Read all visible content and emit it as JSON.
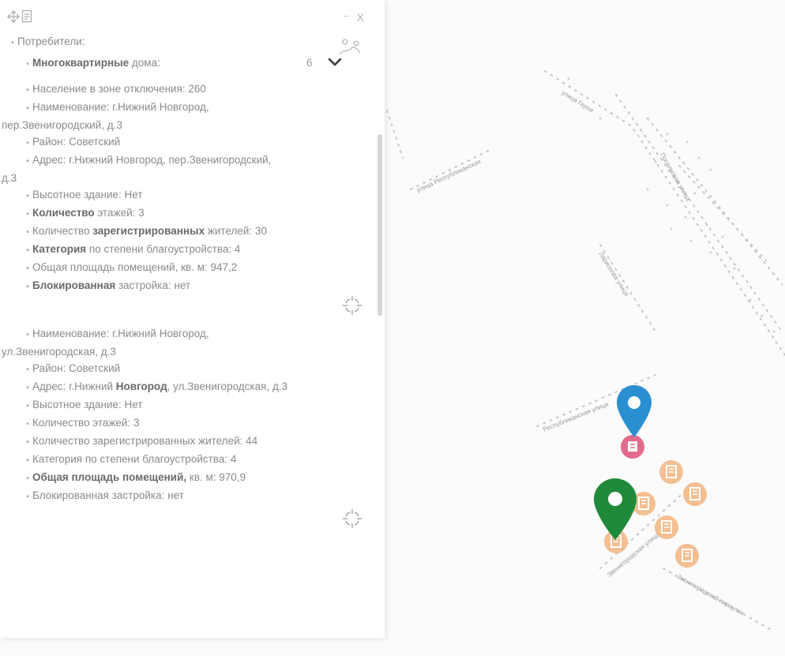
{
  "panel": {
    "header": {
      "move_icon": "move-arrows-icon",
      "export_icon": "export-document-icon",
      "minimize_label": "–",
      "close_label": "X",
      "route_icon": "route-icon"
    },
    "root_label": "Потребители:",
    "group": {
      "label_bold": "Многоквартирные",
      "label_rest": " дома:",
      "count": "6"
    },
    "summary": "Население в зоне отключения: 260",
    "building1": {
      "name_line1": "Наименование: г.Нижний Новгород,",
      "name_line2": "пер.Звенигородский, д.3",
      "district": "Район: Советский",
      "address_line1": "Адрес: г.Нижний Новгород, пер.Звенигородский,",
      "address_line2": "д.3",
      "highrise": "Высотное здание: Нет",
      "floors_bold": "Количество",
      "floors_rest": " этажей: 3",
      "residents_pre": "Количество ",
      "residents_bold": "зарегистрированных",
      "residents_rest": " жителей: 30",
      "category_bold": "Категория",
      "category_rest": " по степени благоустройства: 4",
      "area": "Общая площадь помещений, кв. м: 947,2",
      "blocked_bold": "Блокированная",
      "blocked_rest": " застройка: нет"
    },
    "building2": {
      "name_line1": "Наименование: г.Нижний Новгород,",
      "name_line2": "ул.Звенигородская, д.3",
      "district": "Район: Советский",
      "address_pre": "Адрес: г.Нижний ",
      "address_bold": "Новгород",
      "address_rest": ", ул.Звенигородская, д.3",
      "highrise": "Высотное здание: Нет",
      "floors": "Количество этажей: 3",
      "residents": "Количество зарегистрированных жителей: 44",
      "category": "Категория по степени благоустройства: 4",
      "area_bold1": "Общая площадь",
      "area_mid": " ",
      "area_bold2": "помещений,",
      "area_rest": " кв. м: 970,9",
      "blocked": "Блокированная застройка: нет"
    }
  },
  "map": {
    "streets": {
      "s1": "улица Героя",
      "s2": "улица Республиканская",
      "s3": "Республиканская улица",
      "s4": "Звенигородская улица",
      "s5": "Звенигородский переулок",
      "s6": "Ларионова улица",
      "s7": "Поселковая улица"
    },
    "colors": {
      "blue_marker": "#2a8fd0",
      "green_marker": "#1f8a3a",
      "pink_building": "#e46a8c",
      "orange_building": "#f3b886"
    },
    "markers": {
      "blue": "map-pin-blue",
      "green": "map-pin-green",
      "building": "building-icon"
    }
  }
}
